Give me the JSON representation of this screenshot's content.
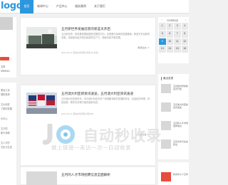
{
  "header": {
    "logo": "logo",
    "nav": [
      "首页",
      "新闻中心",
      "产品中心",
      "服务案例",
      "关于我们"
    ]
  },
  "left": {
    "count_label": "文章",
    "count_value": "9999915",
    "lines": [
      "黑龙江省",
      "理的需求",
      "",
      "文大利亚",
      "了新的发展",
      "",
      "乐中心",
      "",
      "文才的",
      "新兴领域",
      "",
      "文人才的",
      "文化与生态"
    ]
  },
  "articles": [
    {
      "title": "五月新世界发展前景的新蓝天开启",
      "desc": "五月新世界，新发展是围绕国家发展的方向，实现更可持续的发展格局；新蓝天开启新的发展，持续推动经济增长和新质生产力，随着科技不断发展。",
      "meta": "2024-10-11  深圳文化传媒  浏览:99  标签",
      "more": "阅读全文 >>"
    },
    {
      "title": "五月澳大利亚新资讯速览，五月澳大利亚资讯速递",
      "desc": "五月澳大利亚新资讯，本月澳大利亚在多个领域都有新的发展和变化，包括经济政策、科技创新、教育交流等方面的最新动态。",
      "meta": "2024-10-11  深圳文化传媒  浏览:88",
      "more": "阅读全文 >>"
    },
    {
      "title": "五月的人才市场招聘信息全面解析",
      "desc": "",
      "meta": "",
      "more": ""
    }
  ],
  "calendar": {
    "header": "2028年6月",
    "prev": "‹",
    "next": "›",
    "cells": [
      "1",
      "2",
      "3",
      "4",
      "5",
      "6",
      "7",
      "8",
      "9",
      "10",
      "11",
      "12",
      "13",
      "14",
      "15",
      "16"
    ],
    "active_index": 8
  },
  "recent": {
    "title": "最近发表",
    "items": [
      "五月新世界的新蓝天开启",
      "五月澳大利亚新资讯速递",
      "五月的人才市场招聘信息",
      "五月文化与生态建设"
    ]
  },
  "bottom": {
    "item": "新闻中心十五年"
  },
  "watermark": {
    "text": "自动秒收录",
    "sub": "做上链接一来访一次一自动收录"
  },
  "colors": {
    "accent": "#2c97de",
    "red": "#e74c3c"
  }
}
